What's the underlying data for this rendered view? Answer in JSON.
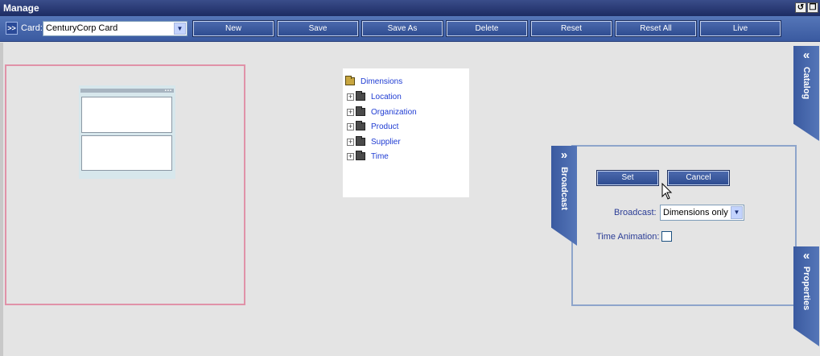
{
  "window": {
    "title": "Manage"
  },
  "toolbar": {
    "expand_label": ">>",
    "card_label": "Card:",
    "card_value": "CenturyCorp Card",
    "buttons": {
      "new": "New",
      "save": "Save",
      "save_as": "Save As",
      "delete": "Delete",
      "reset": "Reset",
      "reset_all": "Reset All",
      "live": "Live"
    }
  },
  "tree": {
    "root": "Dimensions",
    "items": [
      "Location",
      "Organization",
      "Product",
      "Supplier",
      "Time"
    ]
  },
  "broadcast_panel": {
    "set_label": "Set",
    "cancel_label": "Cancel",
    "broadcast_label": "Broadcast:",
    "broadcast_value": "Dimensions only",
    "time_animation_label": "Time Animation:",
    "time_animation_checked": false
  },
  "side_tabs": {
    "catalog": "Catalog",
    "broadcast": "Broadcast",
    "properties": "Properties"
  }
}
